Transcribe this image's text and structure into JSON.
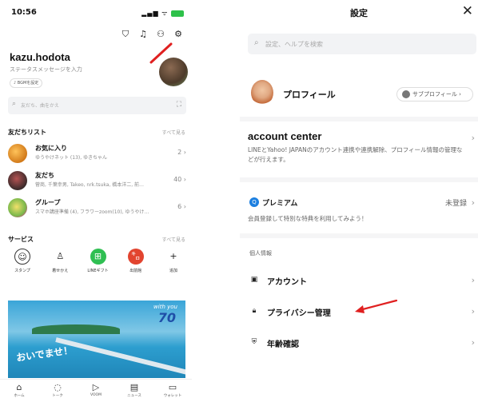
{
  "left": {
    "status": {
      "time": "10:56"
    },
    "profile": {
      "name": "kazu.hodota",
      "status_message": "ステータスメッセージを入力",
      "bgm_label": "BGMを設定"
    },
    "search": {
      "placeholder": "友だち、曲をかえ"
    },
    "friends_section": {
      "title": "友だちリスト",
      "see_all": "すべて見る",
      "rows": [
        {
          "title": "お気に入り",
          "subtitle": "ゆうやけネット (13), ゆきちゃん",
          "count": "2"
        },
        {
          "title": "友だち",
          "subtitle": "菅商, 千葉幸男, Takeo, nrk.tsuka, 橋本洋二, 前…",
          "count": "40"
        },
        {
          "title": "グループ",
          "subtitle": "スマホ講座準備 (4), フラワーzoom(10), ゆうやけ…",
          "count": "6"
        }
      ]
    },
    "services_section": {
      "title": "サービス",
      "see_all": "すべて見る",
      "items": [
        {
          "label": "スタンプ",
          "icon": "smile-icon"
        },
        {
          "label": "着せかえ",
          "icon": "brush-icon"
        },
        {
          "label": "LINEギフト",
          "icon": "gift-icon",
          "color": "#2fbf52"
        },
        {
          "label": "出前館",
          "icon": "delivery-icon",
          "color": "#e2442f"
        },
        {
          "label": "追加",
          "icon": "plus-icon"
        }
      ]
    },
    "banner": {
      "welcome": "おいでませ！",
      "with_you": "with you",
      "seventy": "70"
    },
    "tabbar": [
      {
        "label": "ホーム",
        "icon": "home-icon"
      },
      {
        "label": "トーク",
        "icon": "chat-icon"
      },
      {
        "label": "VOOM",
        "icon": "voom-icon"
      },
      {
        "label": "ニュース",
        "icon": "news-icon"
      },
      {
        "label": "ウォレット",
        "icon": "wallet-icon"
      }
    ]
  },
  "right": {
    "title": "設定",
    "search": {
      "placeholder": "設定、ヘルプを検索"
    },
    "profile": {
      "label": "プロフィール",
      "sub_button": "サブプロフィール"
    },
    "account_center": {
      "title": "account center",
      "description": "LINEとYahoo! JAPANのアカウント連携や連携解除、プロフィール情報の管理などが行えます。"
    },
    "premium": {
      "title": "プレミアム",
      "status": "未登録",
      "description": "会員登録して特別な特典を利用してみよう！"
    },
    "personal_section": {
      "label": "個人情報",
      "items": [
        {
          "label": "アカウント",
          "icon": "id-card-icon"
        },
        {
          "label": "プライバシー管理",
          "icon": "lock-icon"
        },
        {
          "label": "年齢確認",
          "icon": "shield-icon"
        }
      ]
    }
  },
  "accent_colors": {
    "annotation_red": "#e02020",
    "line_green": "#2fbf52"
  }
}
